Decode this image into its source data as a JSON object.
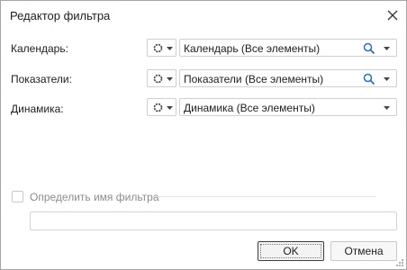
{
  "dialog": {
    "title": "Редактор фильтра",
    "close_icon": "close-icon"
  },
  "rows": [
    {
      "label": "Календарь:",
      "value": "Календарь (Все элементы)",
      "has_search": true
    },
    {
      "label": "Показатели:",
      "value": "Показатели (Все элементы)",
      "has_search": true
    },
    {
      "label": "Динамика:",
      "value": "Динамика (Все элементы)",
      "has_search": false
    }
  ],
  "filter_name": {
    "checkbox_label": "Определить имя фильтра",
    "checked": false,
    "input_value": ""
  },
  "buttons": {
    "ok": "OK",
    "cancel": "Отмена"
  },
  "colors": {
    "border": "#a6a6a6",
    "search_icon": "#2b6cb8",
    "disabled_text": "#8c8c8c"
  }
}
